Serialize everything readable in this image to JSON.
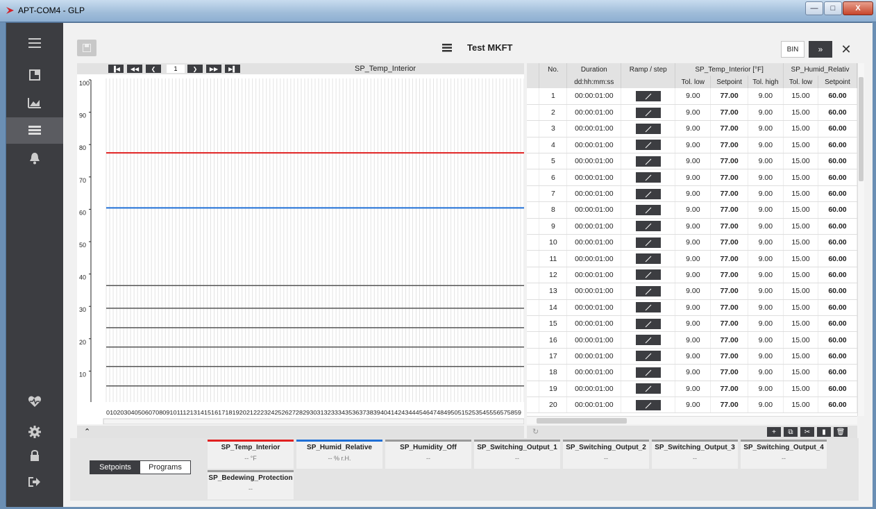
{
  "window": {
    "title": "APT-COM4 - GLP"
  },
  "header": {
    "title": "Test MKFT",
    "bin_label": "BIN",
    "forward_label": "»",
    "close_label": "✕"
  },
  "chart": {
    "title": "SP_Temp_Interior",
    "page": "1",
    "y_ticks": [
      "100",
      "90",
      "80",
      "70",
      "60",
      "50",
      "40",
      "30",
      "20",
      "10"
    ],
    "x_ticks": "0102030405060708091011121314151617181920212223242526272829303132333435363738394041424344454647484950515253545556575859",
    "colors": {
      "temp": "#e02020",
      "humid": "#1f6fd6",
      "other": "#555555"
    }
  },
  "chart_data": {
    "type": "line",
    "title": "SP_Temp_Interior",
    "x": [
      0,
      59
    ],
    "ylim": [
      0,
      100
    ],
    "series": [
      {
        "name": "SP_Temp_Interior",
        "values": [
          77,
          77
        ]
      },
      {
        "name": "SP_Humid_Relative",
        "values": [
          60,
          60
        ]
      }
    ]
  },
  "table": {
    "columns": [
      "No.",
      "Duration",
      "Ramp / step",
      "Tol. low",
      "Setpoint",
      "Tol. high",
      "Tol. low",
      "Setpoint"
    ],
    "group1": "SP_Temp_Interior [°F]",
    "group2": "SP_Humid_Relativ",
    "duration_format": "dd:hh:mm:ss",
    "rows": [
      [
        "1",
        "00:00:01:00",
        "9.00",
        "77.00",
        "9.00",
        "15.00",
        "60.00"
      ],
      [
        "2",
        "00:00:01:00",
        "9.00",
        "77.00",
        "9.00",
        "15.00",
        "60.00"
      ],
      [
        "3",
        "00:00:01:00",
        "9.00",
        "77.00",
        "9.00",
        "15.00",
        "60.00"
      ],
      [
        "4",
        "00:00:01:00",
        "9.00",
        "77.00",
        "9.00",
        "15.00",
        "60.00"
      ],
      [
        "5",
        "00:00:01:00",
        "9.00",
        "77.00",
        "9.00",
        "15.00",
        "60.00"
      ],
      [
        "6",
        "00:00:01:00",
        "9.00",
        "77.00",
        "9.00",
        "15.00",
        "60.00"
      ],
      [
        "7",
        "00:00:01:00",
        "9.00",
        "77.00",
        "9.00",
        "15.00",
        "60.00"
      ],
      [
        "8",
        "00:00:01:00",
        "9.00",
        "77.00",
        "9.00",
        "15.00",
        "60.00"
      ],
      [
        "9",
        "00:00:01:00",
        "9.00",
        "77.00",
        "9.00",
        "15.00",
        "60.00"
      ],
      [
        "10",
        "00:00:01:00",
        "9.00",
        "77.00",
        "9.00",
        "15.00",
        "60.00"
      ],
      [
        "11",
        "00:00:01:00",
        "9.00",
        "77.00",
        "9.00",
        "15.00",
        "60.00"
      ],
      [
        "12",
        "00:00:01:00",
        "9.00",
        "77.00",
        "9.00",
        "15.00",
        "60.00"
      ],
      [
        "13",
        "00:00:01:00",
        "9.00",
        "77.00",
        "9.00",
        "15.00",
        "60.00"
      ],
      [
        "14",
        "00:00:01:00",
        "9.00",
        "77.00",
        "9.00",
        "15.00",
        "60.00"
      ],
      [
        "15",
        "00:00:01:00",
        "9.00",
        "77.00",
        "9.00",
        "15.00",
        "60.00"
      ],
      [
        "16",
        "00:00:01:00",
        "9.00",
        "77.00",
        "9.00",
        "15.00",
        "60.00"
      ],
      [
        "17",
        "00:00:01:00",
        "9.00",
        "77.00",
        "9.00",
        "15.00",
        "60.00"
      ],
      [
        "18",
        "00:00:01:00",
        "9.00",
        "77.00",
        "9.00",
        "15.00",
        "60.00"
      ],
      [
        "19",
        "00:00:01:00",
        "9.00",
        "77.00",
        "9.00",
        "15.00",
        "60.00"
      ],
      [
        "20",
        "00:00:01:00",
        "9.00",
        "77.00",
        "9.00",
        "15.00",
        "60.00"
      ]
    ]
  },
  "bottom": {
    "tab_setpoints": "Setpoints",
    "tab_programs": "Programs",
    "cards": [
      {
        "name": "SP_Temp_Interior",
        "value": "-- °F",
        "color": "#e02020"
      },
      {
        "name": "SP_Humid_Relative",
        "value": "-- % r.H.",
        "color": "#1f6fd6"
      },
      {
        "name": "SP_Humidity_Off",
        "value": "--",
        "color": "#9a9a9a"
      },
      {
        "name": "SP_Switching_Output_1",
        "value": "--",
        "color": "#9a9a9a"
      },
      {
        "name": "SP_Switching_Output_2",
        "value": "--",
        "color": "#9a9a9a"
      },
      {
        "name": "SP_Switching_Output_3",
        "value": "--",
        "color": "#9a9a9a"
      },
      {
        "name": "SP_Switching_Output_4",
        "value": "--",
        "color": "#9a9a9a"
      },
      {
        "name": "SP_Bedewing_Protection",
        "value": "--",
        "color": "#9a9a9a"
      }
    ]
  }
}
